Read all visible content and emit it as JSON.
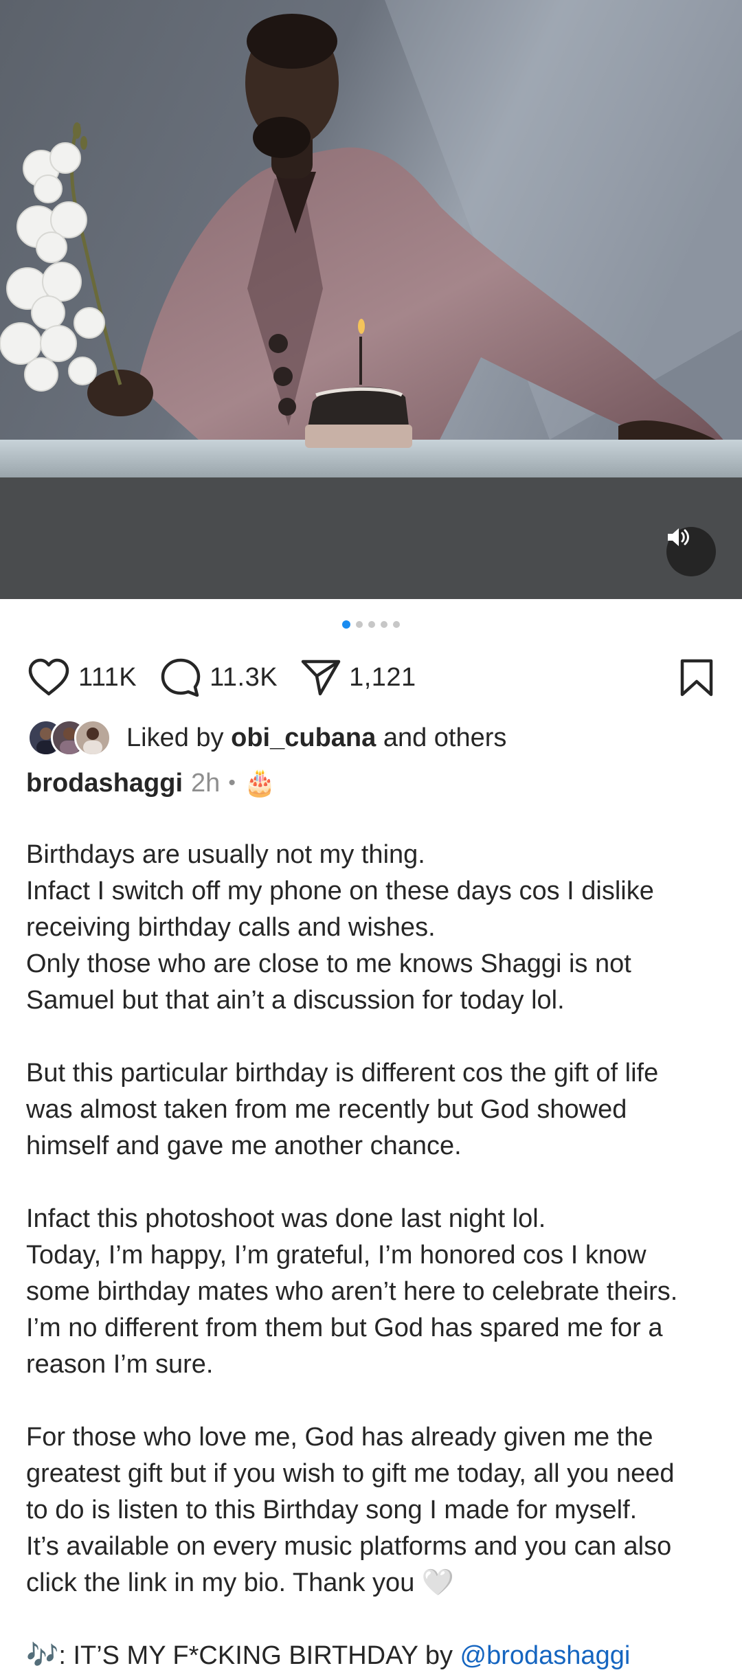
{
  "post": {
    "media": {
      "carousel_count": 5,
      "active_index": 0,
      "icons": {
        "mute": "speaker-icon"
      }
    },
    "actions": {
      "likes": "111K",
      "comments": "11.3K",
      "shares": "1,121",
      "icons": [
        "heart-icon",
        "comment-icon",
        "send-icon",
        "bookmark-icon"
      ]
    },
    "liked_by": {
      "prefix": "Liked by",
      "user": "obi_cubana",
      "suffix": "and others"
    },
    "author": {
      "username": "brodashaggi",
      "time": "2h",
      "separator": "•",
      "emoji": "🎂"
    },
    "caption": {
      "paragraphs": [
        [
          "Birthdays are usually not my thing.",
          "Infact I switch off my phone on these days cos I dislike",
          "receiving birthday calls and wishes.",
          "Only those who are close to me knows Shaggi is not",
          "Samuel but that ain’t a discussion for today lol."
        ],
        [
          "But this particular birthday is different cos the gift of life",
          "was almost taken from me recently but God showed",
          "himself and gave me another chance."
        ],
        [
          "Infact this photoshoot was done last night lol.",
          "Today, I’m happy, I’m grateful, I’m honored cos I know",
          "some birthday mates who aren’t here to celebrate theirs.",
          "I’m no different from them but God has spared me for a",
          "reason I’m sure."
        ],
        [
          "For those who love me, God has already given me the",
          "greatest gift but if you wish to gift me today, all you need",
          "to do is listen to this Birthday song I made for myself.",
          "It’s available on every music platforms and you can also",
          "click the link in my bio. Thank you 🤍"
        ]
      ],
      "music": {
        "emoji": "🎶",
        "text": ": IT’S MY F*CKING BIRTHDAY by ",
        "mention": "@brodashaggi"
      }
    },
    "colors": {
      "accent_blue": "#1a8cf0",
      "mention_blue": "#1565c0",
      "text": "#262626",
      "muted": "#8e8e8e"
    }
  }
}
